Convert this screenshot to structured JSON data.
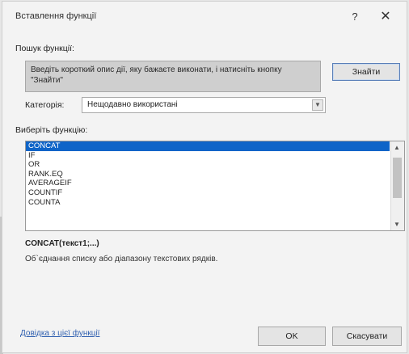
{
  "dialog": {
    "title": "Вставлення функції",
    "help": "?",
    "close": "✕"
  },
  "search": {
    "label": "Пошук функції:",
    "value": "Введіть короткий опис дії, яку бажаєте виконати, і натисніть кнопку \"Знайти\"",
    "button": "Знайти"
  },
  "category": {
    "label": "Категорія:",
    "selected": "Нещодавно використані"
  },
  "functions": {
    "label": "Виберіть функцію:",
    "items": [
      "CONCAT",
      "IF",
      "OR",
      "RANK.EQ",
      "AVERAGEIF",
      "COUNTIF",
      "COUNTA"
    ],
    "selected_index": 0
  },
  "details": {
    "signature": "CONCAT(текст1;...)",
    "description": "Об`єднання списку або діапазону текстових рядків."
  },
  "footer": {
    "help_link": "Довідка з цієї функції",
    "ok": "OK",
    "cancel": "Скасувати"
  }
}
